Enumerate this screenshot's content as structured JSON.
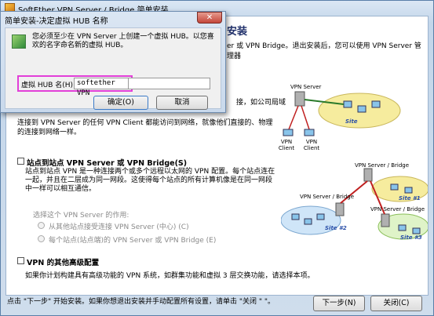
{
  "main_window": {
    "title": "SoftEther VPN Server / Bridge 简单安装"
  },
  "content": {
    "heading": "安装",
    "intro": "er 或 VPN Bridge。退出安装后，您可以使用 VPN Server 管理器",
    "remote_access_desc_partial": "接，如公司局域",
    "remote_access_desc": "连接到 VPN Server 的任何 VPN Client 都能访问到网络，就像他们直接的、物理的连接到网络一样。",
    "site_to_site": {
      "title": "站点到站点 VPN Server 或 VPN Bridge(S)",
      "desc": "站点到站点 VPN 是一种连接两个或多个远程以太网的 VPN 配置。每个站点连在一起，并且在二层成为同一网段。这使得每个站点的所有计算机像是在同一网段中一样可以相互通信。",
      "role_title": "选择这个 VPN Server 的作用:",
      "option_center": "从其他站点接受连接 VPN Server (中心) (C)",
      "option_edge": "每个站点(站点端)的 VPN Server 或 VPN Bridge (E)"
    },
    "advanced": {
      "title": "VPN 的其他高级配置",
      "desc": "如果你计划构建具有高级功能的 VPN 系统，如群集功能和虚拟 3 层交换功能，请选择本项。"
    },
    "diagram1": {
      "server_label": "VPN Server",
      "client_a": "VPN Client",
      "client_b": "VPN Client",
      "site_label": "Site"
    },
    "diagram2": {
      "server_a": "VPN Server / Bridge",
      "server_b": "VPN Server / Bridge",
      "server_c": "VPN Server / Bridge",
      "site1": "Site #1",
      "site2": "Site #2",
      "site3": "Site #3"
    }
  },
  "footer": {
    "note": "点击 \"下一步\" 开始安装。如果你想退出安装并手动配置所有设置，请单击 \"关闭 \" \"。",
    "next_button": "下一步(N)",
    "close_button": "关闭(C)"
  },
  "dialog": {
    "title": "简单安装-决定虚拟 HUB 名称",
    "close_glyph": "✕",
    "message": "您必须至少在 VPN Server 上创建一个虚拟 HUB。以您喜欢的名字命名新的虚拟 HUB。",
    "field_label": "虚拟 HUB 名(H):",
    "field_value": "softether VPN",
    "ok_button": "确定(O)",
    "cancel_button": "取消"
  },
  "colors": {
    "accent": "#e23fd8",
    "heading": "#1f2f6a"
  }
}
